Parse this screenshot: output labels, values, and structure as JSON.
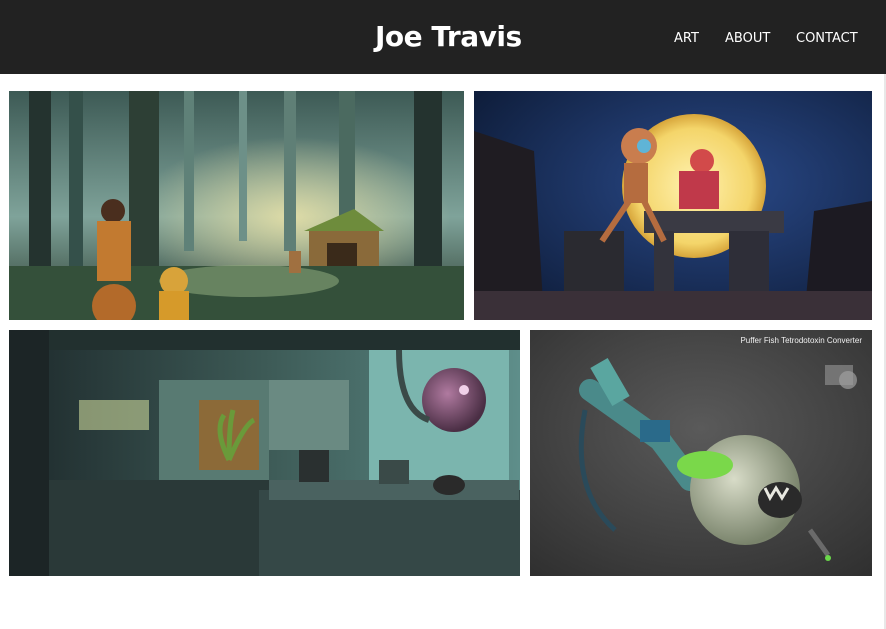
{
  "header": {
    "title": "Joe Travis",
    "nav": {
      "art": "ART",
      "about": "ABOUT",
      "contact": "CONTACT"
    }
  },
  "gallery": {
    "tiles": [
      {
        "icon": "forest-scene-image"
      },
      {
        "icon": "moon-robots-image"
      },
      {
        "icon": "laboratory-scene-image"
      },
      {
        "icon": "pufferfish-device-image",
        "caption": "Puffer Fish Tetrodotoxin Converter"
      }
    ]
  },
  "colors": {
    "header_bg": "#222222",
    "header_text": "#ffffff",
    "page_bg": "#ffffff"
  }
}
